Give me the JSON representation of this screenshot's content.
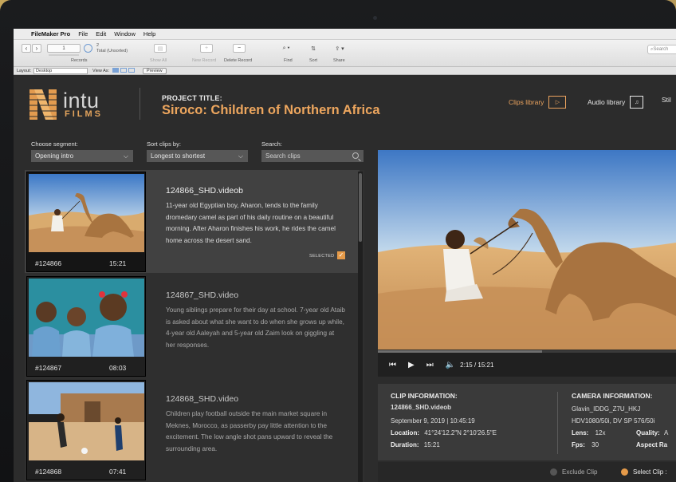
{
  "menubar": {
    "app_name": "FileMaker Pro",
    "items": [
      "File",
      "Edit",
      "Window",
      "Help"
    ]
  },
  "toolbar": {
    "record_number": "1",
    "total_count": "2",
    "total_label": "Total (Unsorted)",
    "records_label": "Records",
    "show_all_label": "Show All",
    "new_record_label": "New Record",
    "delete_record_label": "Delete Record",
    "find_label": "Find",
    "sort_label": "Sort",
    "share_label": "Share",
    "search_placeholder": "Search"
  },
  "layoutbar": {
    "layout_label": "Layout:",
    "layout_value": "Desktop",
    "view_as_label": "View As:",
    "preview_label": "Preview"
  },
  "header": {
    "logo_text": "intu",
    "logo_sub": "FILMS",
    "project_label": "PROJECT TITLE:",
    "project_title": "Siroco: Children of Northern Africa"
  },
  "nav": {
    "clips_library": "Clips library",
    "audio_library": "Audio library",
    "stills_partial": "Stil"
  },
  "filters": {
    "segment_label": "Choose segment:",
    "segment_value": "Opening intro",
    "sort_label": "Sort clips by:",
    "sort_value": "Longest to shortest",
    "search_label": "Search:",
    "search_placeholder": "Search clips"
  },
  "clips": [
    {
      "id": "#124866",
      "duration": "15:21",
      "name": "124866_SHD.videob",
      "description": "11-year old Egyptian boy, Aharon, tends to the family dromedary camel as part of his daily routine on a beautiful morning.  After Aharon finishes his work, he rides the camel home across the desert sand.",
      "selected_label": "SELECTED"
    },
    {
      "id": "#124867",
      "duration": "08:03",
      "name": "124867_SHD.video",
      "description": "Young siblings prepare for their day at school.  7-year old Ataib is asked about what she want to do when she grows up while, 4-year old Aaleyah and 5-year old Zaim look on giggling at her responses."
    },
    {
      "id": "#124868",
      "duration": "07:41",
      "name": "124868_SHD.video",
      "description": "Children play football outside the main market square in Meknes, Morocco, as passerby pay little attention to the excitement.  The low angle shot pans upward to reveal the surrounding area."
    }
  ],
  "player": {
    "timecode": "2:15 / 15:21",
    "progress": 0.55
  },
  "clip_info": {
    "header": "CLIP INFORMATION:",
    "filename": "124866_SHD.videob",
    "date_time": "September 9, 2019  |  10:45:19",
    "location_label": "Location:",
    "location_value": "41°24'12.2\"N   2°10'26.5\"E",
    "duration_label": "Duration:",
    "duration_value": "15:21"
  },
  "camera_info": {
    "header": "CAMERA INFORMATION:",
    "model": "Glavin_IDDG_Z7U_HKJ",
    "format": "HDV1080/50i, DV SP 576/50i",
    "lens_label": "Lens:",
    "lens_value": "12x",
    "fps_label": "Fps:",
    "fps_value": "30",
    "quality_label": "Quality:",
    "quality_partial": "A",
    "aspect_partial": "Aspect Ra"
  },
  "footer": {
    "exclude_label": "Exclude Clip",
    "select_label": "Select Clip :"
  },
  "colors": {
    "accent": "#eba35e",
    "panel": "#2c2c2c",
    "selected_row": "#414141"
  }
}
